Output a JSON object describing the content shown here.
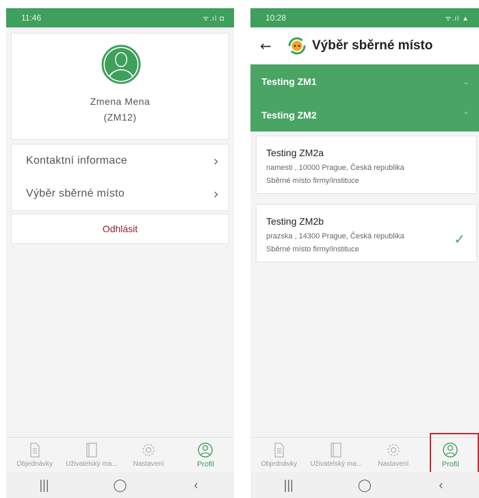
{
  "left": {
    "status_time": "11:46",
    "status_icons": "ᯤ.ıl ◘",
    "profile": {
      "name": "Zmena  Mena",
      "id": "(ZM12)"
    },
    "menu": [
      {
        "label": "Kontaktní informace"
      },
      {
        "label": "Výběr sběrné místo"
      }
    ],
    "logout_label": "Odhlásit"
  },
  "right": {
    "status_time": "10:28",
    "status_icons": "ᯤ.ıl ▲",
    "header_title": "Výběr sběrné místo",
    "groups": [
      {
        "name": "Testing ZM1",
        "expanded": false
      },
      {
        "name": "Testing ZM2",
        "expanded": true
      }
    ],
    "locations": [
      {
        "name": "Testing ZM2a",
        "address": "namesti , 10000 Prague, Česká republika",
        "type": "Sběrné místo firmy/instituce",
        "selected": false
      },
      {
        "name": "Testing ZM2b",
        "address": "prazska , 14300 Prague, Česká republika",
        "type": "Sběrné místo firmy/instituce",
        "selected": true
      }
    ]
  },
  "bottom_nav": [
    {
      "label": "Objednávky",
      "icon": "document-icon",
      "active": false
    },
    {
      "label": "Uživatelský ma...",
      "icon": "book-icon",
      "active": false
    },
    {
      "label": "Nastavení",
      "icon": "gear-icon",
      "active": false
    },
    {
      "label": "Profil",
      "icon": "profile-icon",
      "active": true
    }
  ],
  "system_bar": {
    "recent": "|||",
    "home": "◯",
    "back": "‹"
  },
  "colors": {
    "brand_green": "#3f9f5c",
    "group_green": "#4aa565",
    "logout_red": "#8b2332",
    "highlight_red": "#c0292f"
  }
}
